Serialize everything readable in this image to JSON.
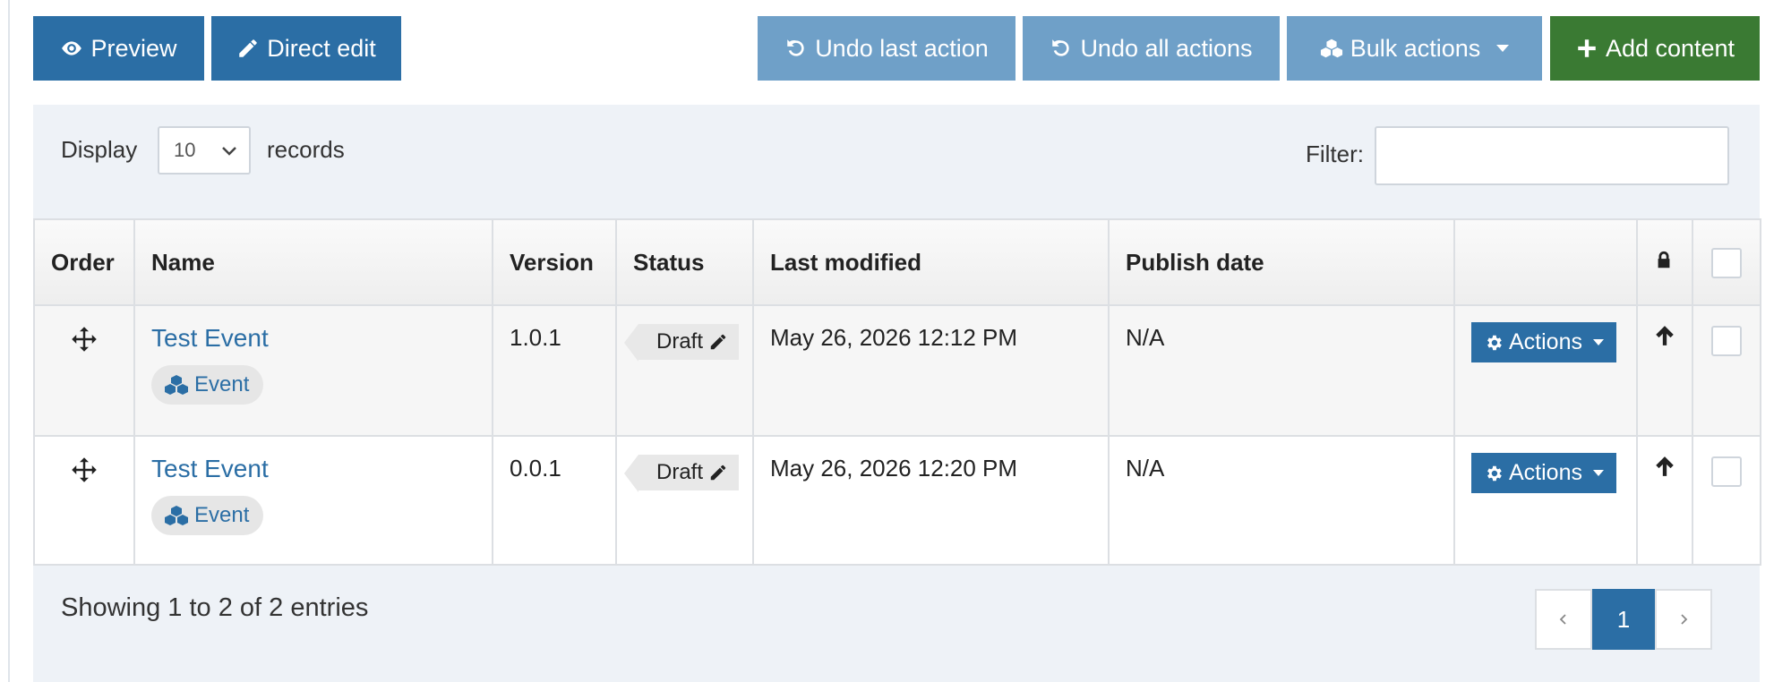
{
  "toolbar": {
    "preview_label": "Preview",
    "direct_edit_label": "Direct edit",
    "undo_last_label": "Undo last action",
    "undo_all_label": "Undo all actions",
    "bulk_actions_label": "Bulk actions",
    "add_content_label": "Add content"
  },
  "length_control": {
    "prefix": "Display",
    "value": "10",
    "suffix": "records"
  },
  "filter": {
    "label": "Filter:",
    "value": ""
  },
  "table": {
    "headers": {
      "order": "Order",
      "name": "Name",
      "version": "Version",
      "status": "Status",
      "last_modified": "Last modified",
      "publish_date": "Publish date"
    },
    "rows": [
      {
        "name": "Test Event",
        "type": "Event",
        "version": "1.0.1",
        "status": "Draft",
        "last_modified": "May 26, 2026 12:12 PM",
        "publish_date": "N/A",
        "actions_label": "Actions"
      },
      {
        "name": "Test Event",
        "type": "Event",
        "version": "0.0.1",
        "status": "Draft",
        "last_modified": "May 26, 2026 12:20 PM",
        "publish_date": "N/A",
        "actions_label": "Actions"
      }
    ]
  },
  "footer": {
    "showing_text": "Showing 1 to 2 of 2 entries",
    "current_page": "1"
  },
  "icons": {
    "preview": "eye-icon",
    "direct_edit": "pencil-icon",
    "undo": "undo-icon",
    "bulk": "cubes-icon",
    "add": "plus-icon",
    "order": "move-icon",
    "type": "cubes-icon",
    "status_edit": "pencil-icon",
    "actions": "gear-icon",
    "lock": "lock-icon",
    "move_up": "arrow-up-icon"
  },
  "colors": {
    "primary": "#2b6ea5",
    "primary_light": "#6fa0c8",
    "success": "#3a7a33",
    "panel_bg": "#eef2f7"
  }
}
